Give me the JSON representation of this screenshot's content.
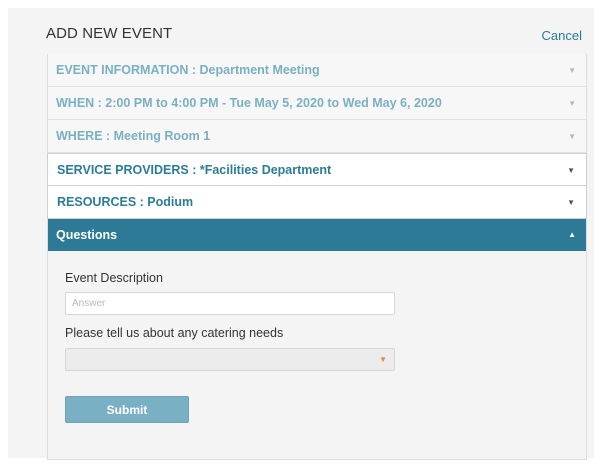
{
  "header": {
    "title": "ADD NEW EVENT",
    "cancel_label": "Cancel"
  },
  "accordion": {
    "event_information": "EVENT INFORMATION : Department Meeting",
    "when": "WHEN : 2:00 PM to 4:00 PM - Tue May 5, 2020 to Wed May 6, 2020",
    "where": "WHERE : Meeting Room 1",
    "service_providers": "SERVICE PROVIDERS : *Facilities Department",
    "resources": "RESOURCES : Podium",
    "questions": "Questions"
  },
  "icons": {
    "collapsed": "chevron-down-icon",
    "expanded": "chevron-up-icon"
  },
  "glyphs": {
    "down": "▼",
    "up": "▲"
  },
  "questions": {
    "event_description_label": "Event Description",
    "answer_placeholder": "Answer",
    "answer_value": "",
    "catering_label": "Please tell us about any catering needs",
    "catering_selected": "",
    "submit_label": "Submit"
  },
  "colors": {
    "accent": "#2c7a95",
    "link": "#2b7c96",
    "completed_text": "#7ab0c3",
    "submit_button": "#7ab0c3",
    "select_caret": "#e8873a"
  }
}
